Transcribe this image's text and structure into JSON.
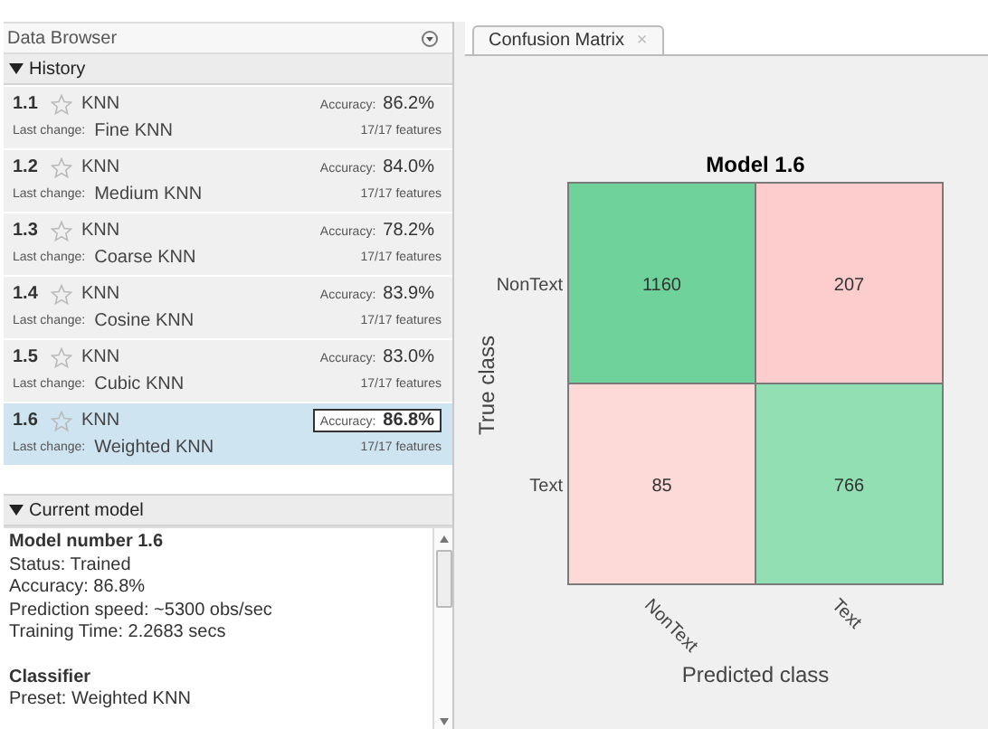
{
  "data_browser": {
    "title": "Data Browser"
  },
  "history": {
    "title": "History",
    "items": [
      {
        "number": "1.1",
        "model": "KNN",
        "accuracy_label": "Accuracy:",
        "accuracy": "86.2%",
        "change_label": "Last change:",
        "change": "Fine KNN",
        "features": "17/17 features",
        "selected": false
      },
      {
        "number": "1.2",
        "model": "KNN",
        "accuracy_label": "Accuracy:",
        "accuracy": "84.0%",
        "change_label": "Last change:",
        "change": "Medium KNN",
        "features": "17/17 features",
        "selected": false
      },
      {
        "number": "1.3",
        "model": "KNN",
        "accuracy_label": "Accuracy:",
        "accuracy": "78.2%",
        "change_label": "Last change:",
        "change": "Coarse KNN",
        "features": "17/17 features",
        "selected": false
      },
      {
        "number": "1.4",
        "model": "KNN",
        "accuracy_label": "Accuracy:",
        "accuracy": "83.9%",
        "change_label": "Last change:",
        "change": "Cosine KNN",
        "features": "17/17 features",
        "selected": false
      },
      {
        "number": "1.5",
        "model": "KNN",
        "accuracy_label": "Accuracy:",
        "accuracy": "83.0%",
        "change_label": "Last change:",
        "change": "Cubic KNN",
        "features": "17/17 features",
        "selected": false
      },
      {
        "number": "1.6",
        "model": "KNN",
        "accuracy_label": "Accuracy:",
        "accuracy": "86.8%",
        "change_label": "Last change:",
        "change": "Weighted KNN",
        "features": "17/17 features",
        "selected": true
      }
    ]
  },
  "current_model": {
    "title": "Current model",
    "lines": [
      {
        "kind": "heading",
        "text": "Model number 1.6"
      },
      {
        "kind": "line",
        "text": "Status: Trained"
      },
      {
        "kind": "line",
        "text": "Accuracy: 86.8%"
      },
      {
        "kind": "line",
        "text": "Prediction speed: ~5300 obs/sec"
      },
      {
        "kind": "line",
        "text": "Training Time: 2.2683 secs"
      },
      {
        "kind": "section",
        "text": "Classifier"
      },
      {
        "kind": "line",
        "text": "Preset: Weighted KNN"
      }
    ]
  },
  "tab": {
    "label": "Confusion Matrix",
    "close": "×"
  },
  "confusion_matrix": {
    "title": "Model 1.6",
    "ylabel": "True class",
    "xlabel": "Predicted class",
    "row_labels": [
      "NonText",
      "Text"
    ],
    "col_labels": [
      "NonText",
      "Text"
    ],
    "cells": [
      [
        {
          "value": "1160",
          "color": "#6fd29b"
        },
        {
          "value": "207",
          "color": "#fdcccc"
        }
      ],
      [
        {
          "value": "85",
          "color": "#fddad8"
        },
        {
          "value": "766",
          "color": "#93dfb4"
        }
      ]
    ]
  }
}
